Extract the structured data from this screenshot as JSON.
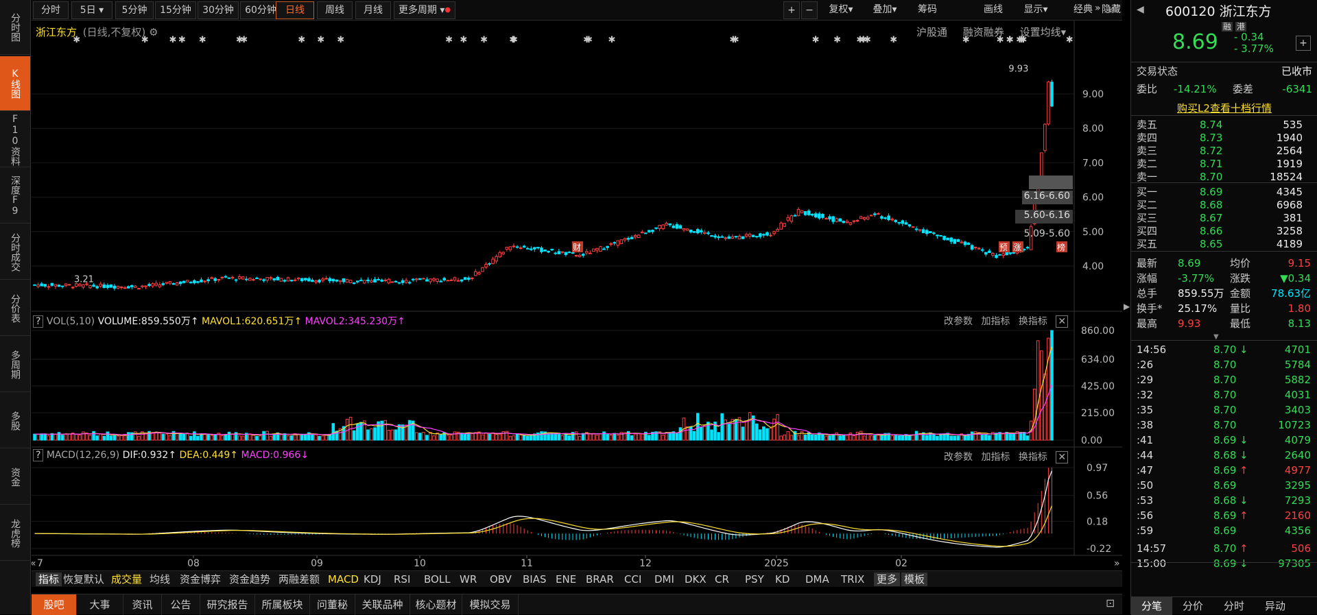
{
  "left_nav": [
    "分时图",
    "K线图",
    "F10资料",
    "深度F9",
    "分时成交",
    "分价表",
    "多周期",
    "多股",
    "资金",
    "龙虎榜"
  ],
  "toolbar": {
    "periods": [
      "分时",
      "5日",
      "5分钟",
      "15分钟",
      "30分钟",
      "60分钟",
      "日线",
      "周线",
      "月线",
      "更多周期"
    ],
    "active_period": "日线",
    "right": [
      "复权",
      "叠加",
      "筹码",
      "画线",
      "显示",
      "经典",
      "隐藏"
    ]
  },
  "chart_header": {
    "stock_name": "浙江东方",
    "mode": "(日线,不复权)",
    "links": [
      "沪股通",
      "融资融券",
      "设置均线"
    ]
  },
  "price_axis": [
    "9.00",
    "8.00",
    "7.00",
    "6.00",
    "5.00",
    "4.00"
  ],
  "price_annotations": {
    "high": "9.93",
    "low": "3.21"
  },
  "chip_ranges": [
    "6.16-6.60",
    "5.60-6.16",
    "5.09-5.60"
  ],
  "event_markers": [
    "财",
    "预",
    "涨",
    "榜"
  ],
  "volume_header": {
    "name": "VOL(5,10)",
    "volume": "VOLUME:859.550万",
    "ma1": "MAVOL1:620.651万",
    "ma2": "MAVOL2:345.230万",
    "tools": [
      "改参数",
      "加指标",
      "换指标"
    ]
  },
  "volume_axis": [
    "860.00",
    "634.00",
    "425.00",
    "215.00",
    "0.00"
  ],
  "macd_header": {
    "name": "MACD(12,26,9)",
    "dif": "DIF:0.932",
    "dea": "DEA:0.449",
    "macd": "MACD:0.966",
    "tools": [
      "改参数",
      "加指标",
      "换指标"
    ]
  },
  "macd_axis": [
    "0.97",
    "0.56",
    "0.18",
    "-0.22"
  ],
  "x_axis": [
    "7",
    "08",
    "09",
    "10",
    "11",
    "12",
    "2025",
    "02"
  ],
  "indicator_tabs": [
    "指标",
    "恢复默认",
    "成交量",
    "均线",
    "资金博弈",
    "资金趋势",
    "两融差额",
    "MACD",
    "KDJ",
    "RSI",
    "BOLL",
    "WR",
    "OBV",
    "BIAS",
    "ENE",
    "BRAR",
    "CCI",
    "DMI",
    "DKX",
    "CR",
    "PSY",
    "KD",
    "DMA",
    "TRIX",
    "更多",
    "模板"
  ],
  "bottom_tabs": [
    "股吧",
    "大事",
    "资讯",
    "公告",
    "研究报告",
    "所属板块",
    "问董秘",
    "关联品种",
    "核心题材",
    "模拟交易"
  ],
  "quote": {
    "code": "600120",
    "name": "浙江东方",
    "tags": [
      "融",
      "港"
    ],
    "price": "8.69",
    "change": "- 0.34",
    "change_pct": "- 3.77%",
    "status_label": "交易状态",
    "status": "已收市",
    "weibi_label": "委比",
    "weibi": "-14.21%",
    "weicha_label": "委差",
    "weicha": "-6341",
    "l2_link": "购买L2查看十档行情",
    "asks": [
      {
        "label": "卖五",
        "price": "8.74",
        "vol": "535"
      },
      {
        "label": "卖四",
        "price": "8.73",
        "vol": "1940"
      },
      {
        "label": "卖三",
        "price": "8.72",
        "vol": "2564"
      },
      {
        "label": "卖二",
        "price": "8.71",
        "vol": "1919"
      },
      {
        "label": "卖一",
        "price": "8.70",
        "vol": "18524"
      }
    ],
    "bids": [
      {
        "label": "买一",
        "price": "8.69",
        "vol": "4345"
      },
      {
        "label": "买二",
        "price": "8.68",
        "vol": "6968"
      },
      {
        "label": "买三",
        "price": "8.67",
        "vol": "381"
      },
      {
        "label": "买四",
        "price": "8.66",
        "vol": "3258"
      },
      {
        "label": "买五",
        "price": "8.65",
        "vol": "4189"
      }
    ],
    "stats": [
      {
        "l1": "最新",
        "v1": "8.69",
        "l2": "均价",
        "v2": "9.15"
      },
      {
        "l1": "涨幅",
        "v1": "-3.77%",
        "l2": "涨跌",
        "v2": "▼0.34"
      },
      {
        "l1": "总手",
        "v1": "859.55万",
        "l2": "金额",
        "v2": "78.63亿"
      },
      {
        "l1": "换手*",
        "v1": "25.17%",
        "l2": "量比",
        "v2": "1.80"
      },
      {
        "l1": "最高",
        "v1": "9.93",
        "l2": "最低",
        "v2": "8.13"
      }
    ],
    "ticks": [
      {
        "t": "14:56",
        "p": "8.70",
        "a": "↓",
        "v": "4701"
      },
      {
        "t": ":26",
        "p": "8.70",
        "a": "",
        "v": "5784"
      },
      {
        "t": ":29",
        "p": "8.70",
        "a": "",
        "v": "5882"
      },
      {
        "t": ":32",
        "p": "8.70",
        "a": "",
        "v": "4031"
      },
      {
        "t": ":35",
        "p": "8.70",
        "a": "",
        "v": "3403"
      },
      {
        "t": ":38",
        "p": "8.70",
        "a": "",
        "v": "10723"
      },
      {
        "t": ":41",
        "p": "8.69",
        "a": "↓",
        "v": "4079"
      },
      {
        "t": ":44",
        "p": "8.68",
        "a": "↓",
        "v": "2640"
      },
      {
        "t": ":47",
        "p": "8.69",
        "a": "↑",
        "v": "4977"
      },
      {
        "t": ":50",
        "p": "8.69",
        "a": "",
        "v": "3295"
      },
      {
        "t": ":53",
        "p": "8.68",
        "a": "↓",
        "v": "7293"
      },
      {
        "t": ":56",
        "p": "8.69",
        "a": "↑",
        "v": "2160"
      },
      {
        "t": ":59",
        "p": "8.69",
        "a": "",
        "v": "4356"
      },
      {
        "t": "14:57",
        "p": "8.70",
        "a": "↑",
        "v": "506"
      },
      {
        "t": "15:00",
        "p": "8.69",
        "a": "↓",
        "v": "97305"
      }
    ],
    "bottom_tabs": [
      "分笔",
      "分价",
      "分时",
      "异动"
    ]
  },
  "colors": {
    "up": "#ff4040",
    "down": "#00e5ff",
    "accent": "#e0571a",
    "ma1": "#ffe030",
    "ma2": "#ff40ff"
  }
}
